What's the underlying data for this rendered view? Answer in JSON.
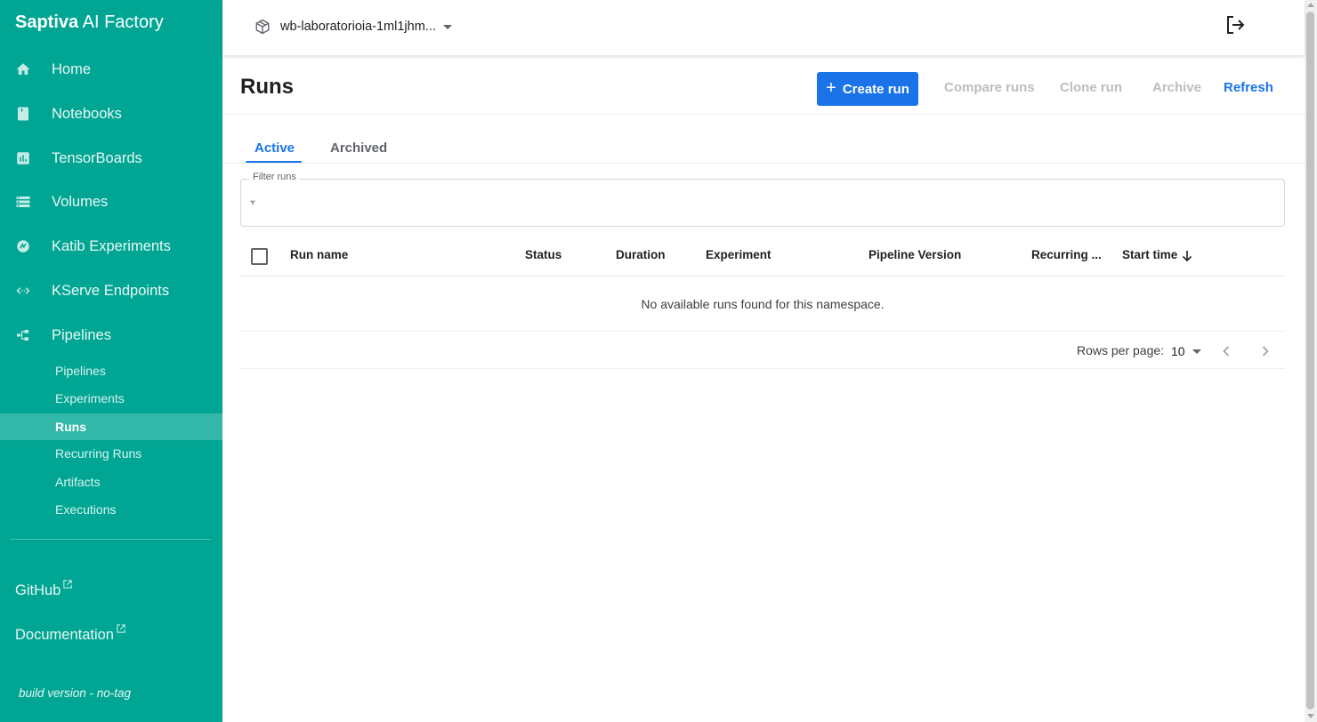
{
  "brand": {
    "bold": "Saptiva",
    "rest": " AI Factory"
  },
  "sidebar": {
    "items": [
      {
        "label": "Home",
        "icon": "home-icon"
      },
      {
        "label": "Notebooks",
        "icon": "notebook-icon"
      },
      {
        "label": "TensorBoards",
        "icon": "tensorboard-icon"
      },
      {
        "label": "Volumes",
        "icon": "volumes-icon"
      },
      {
        "label": "Katib Experiments",
        "icon": "katib-icon"
      },
      {
        "label": "KServe Endpoints",
        "icon": "kserve-icon"
      },
      {
        "label": "Pipelines",
        "icon": "pipelines-icon"
      }
    ],
    "sub_items": [
      {
        "label": "Pipelines"
      },
      {
        "label": "Experiments"
      },
      {
        "label": "Runs",
        "active": true
      },
      {
        "label": "Recurring Runs"
      },
      {
        "label": "Artifacts"
      },
      {
        "label": "Executions"
      }
    ],
    "links": [
      {
        "label": "GitHub",
        "icon": "external-link-icon"
      },
      {
        "label": "Documentation",
        "icon": "external-link-icon"
      }
    ],
    "build_version": "build version - no-tag"
  },
  "topbar": {
    "namespace": "wb-laboratorioia-1ml1jhm...",
    "namespace_icon": "cube-icon",
    "logout_icon": "logout-icon"
  },
  "page": {
    "title": "Runs",
    "create_label": "Create run",
    "compare_label": "Compare runs",
    "clone_label": "Clone run",
    "archive_label": "Archive",
    "refresh_label": "Refresh"
  },
  "tabs": [
    {
      "label": "Active",
      "active": true
    },
    {
      "label": "Archived",
      "active": false
    }
  ],
  "filter": {
    "label": "Filter runs",
    "icon": "filter-icon"
  },
  "table": {
    "columns": [
      "Run name",
      "Status",
      "Duration",
      "Experiment",
      "Pipeline Version",
      "Recurring ...",
      "Start time"
    ],
    "sort_icon": "arrow-down-icon",
    "empty_message": "No available runs found for this namespace."
  },
  "pagination": {
    "rows_per_page_label": "Rows per page:",
    "rows_per_page": "10"
  },
  "colors": {
    "sidebar": "#00a693",
    "sidebar_active": "#33b8a9",
    "primary": "#1a73e8",
    "disabled": "#bdbdbd"
  }
}
